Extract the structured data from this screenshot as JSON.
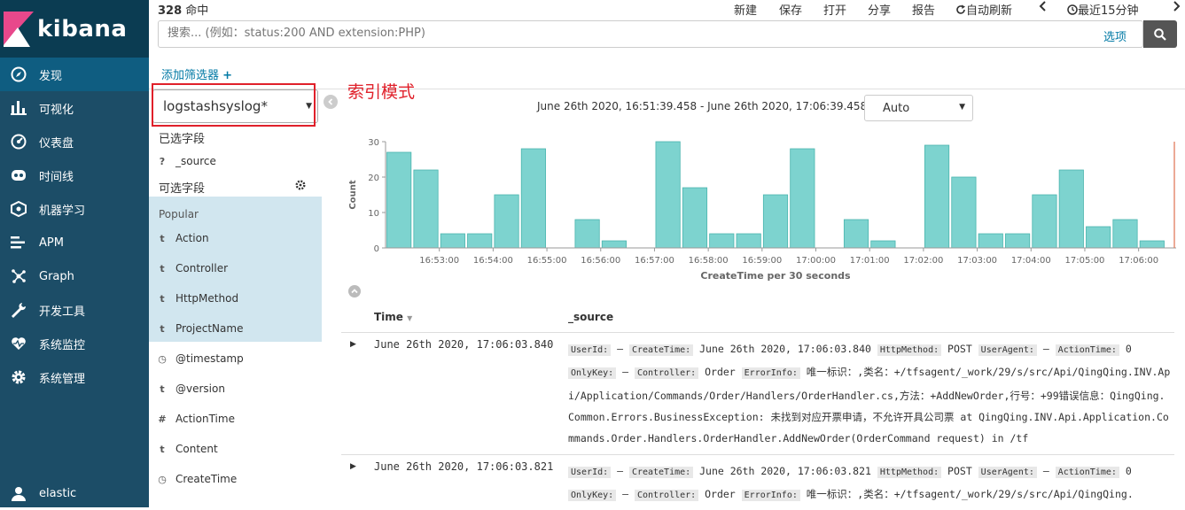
{
  "app": {
    "logo_text": "kibana",
    "brand_color": "#1c4d67",
    "nav_active_color": "#0f5d81"
  },
  "nav": [
    {
      "label": "发现",
      "icon": "compass-icon",
      "active": true
    },
    {
      "label": "可视化",
      "icon": "bar-chart-icon"
    },
    {
      "label": "仪表盘",
      "icon": "dashboard-icon"
    },
    {
      "label": "时间线",
      "icon": "timeline-icon"
    },
    {
      "label": "机器学习",
      "icon": "machine-learning-icon"
    },
    {
      "label": "APM",
      "icon": "apm-icon"
    },
    {
      "label": "Graph",
      "icon": "graph-icon"
    },
    {
      "label": "开发工具",
      "icon": "wrench-icon"
    },
    {
      "label": "系统监控",
      "icon": "heartbeat-icon"
    },
    {
      "label": "系统管理",
      "icon": "gear-icon"
    }
  ],
  "user": {
    "label": "elastic",
    "icon": "user-icon"
  },
  "topbar": {
    "hits_count": "328",
    "hits_label": "命中",
    "new": "新建",
    "save": "保存",
    "open": "打开",
    "share": "分享",
    "report": "报告",
    "auto_refresh": "自动刷新",
    "time_picker": "最近15分钟"
  },
  "search": {
    "placeholder": "搜索... (例如：status:200 AND extension:PHP)",
    "options": "选项"
  },
  "filters": {
    "add_filter": "添加筛选器"
  },
  "fieldlist": {
    "index_pattern": "logstashsyslog*",
    "selected_title": "已选字段",
    "selected_fields": [
      {
        "type": "?",
        "name": "_source"
      }
    ],
    "available_title": "可选字段",
    "popular_label": "Popular",
    "popular_fields": [
      {
        "type": "t",
        "name": "Action"
      },
      {
        "type": "t",
        "name": "Controller"
      },
      {
        "type": "t",
        "name": "HttpMethod"
      },
      {
        "type": "t",
        "name": "ProjectName"
      }
    ],
    "other_fields": [
      {
        "type": "◷",
        "name": "@timestamp"
      },
      {
        "type": "t",
        "name": "@version"
      },
      {
        "type": "#",
        "name": "ActionTime"
      },
      {
        "type": "t",
        "name": "Content"
      },
      {
        "type": "◷",
        "name": "CreateTime"
      }
    ]
  },
  "annotation": "索引模式",
  "time_range": "June 26th 2020, 16:51:39.458 - June 26th 2020, 17:06:39.458 —",
  "interval": "Auto",
  "chart_data": {
    "type": "bar",
    "bar_color": "#7dd3cf",
    "ylabel": "Count",
    "xlabel": "CreateTime per 30 seconds",
    "ylim": [
      0,
      30
    ],
    "yticks": [
      0,
      10,
      20,
      30
    ],
    "xticks": [
      "16:53:00",
      "16:54:00",
      "16:55:00",
      "16:56:00",
      "16:57:00",
      "16:58:00",
      "16:59:00",
      "17:00:00",
      "17:01:00",
      "17:02:00",
      "17:03:00",
      "17:04:00",
      "17:05:00",
      "17:06:00"
    ],
    "x_start": "16:52:00",
    "bucket_seconds": 30,
    "values": [
      27,
      22,
      4,
      4,
      15,
      28,
      0,
      8,
      2,
      0,
      30,
      17,
      4,
      4,
      15,
      28,
      0,
      8,
      2,
      0,
      29,
      20,
      4,
      4,
      15,
      22,
      6,
      8,
      2
    ]
  },
  "table": {
    "col_time": "Time",
    "col_source": "_source",
    "rows": [
      {
        "time": "June 26th 2020, 17:06:03.840",
        "source": [
          {
            "k": "UserId:",
            "v": " – "
          },
          {
            "k": "CreateTime:",
            "v": " June 26th 2020, 17:06:03.840 "
          },
          {
            "k": "HttpMethod:",
            "v": " POST "
          },
          {
            "k": "UserAgent:",
            "v": " – "
          },
          {
            "k": "ActionTime:",
            "v": " 0\n"
          },
          {
            "k": "OnlyKey:",
            "v": " – "
          },
          {
            "k": "Controller:",
            "v": " Order "
          },
          {
            "k": "ErrorInfo:",
            "v": " 唯一标识：,类名：+/tfsagent/_work/29/s/src/Api/QingQing.INV.Api/Application/Commands/Order/Handlers/OrderHandler.cs,方法：+AddNewOrder,行号：+99错误信息：QingQing.Common.Errors.BusinessException: 未找到对应开票申请，不允许开具公司票 at QingQing.INV.Api.Application.Commands.Order.Handlers.OrderHandler.AddNewOrder(OrderCommand request) in /tf"
          }
        ]
      },
      {
        "time": "June 26th 2020, 17:06:03.821",
        "source": [
          {
            "k": "UserId:",
            "v": " – "
          },
          {
            "k": "CreateTime:",
            "v": " June 26th 2020, 17:06:03.821 "
          },
          {
            "k": "HttpMethod:",
            "v": " POST "
          },
          {
            "k": "UserAgent:",
            "v": " – "
          },
          {
            "k": "ActionTime:",
            "v": " 0\n"
          },
          {
            "k": "OnlyKey:",
            "v": " – "
          },
          {
            "k": "Controller:",
            "v": " Order "
          },
          {
            "k": "ErrorInfo:",
            "v": " 唯一标识：,类名：+/tfsagent/_work/29/s/src/Api/QingQing."
          }
        ]
      }
    ]
  }
}
